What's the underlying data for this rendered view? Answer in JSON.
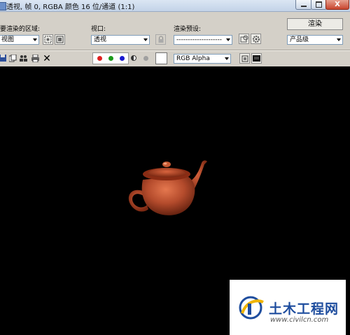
{
  "window": {
    "title": "透视, 帧 0, RGBA 颜色 16 位/通道 (1:1)",
    "close_label": "X"
  },
  "toolbar": {
    "area_label": "要渲染的区域:",
    "area_value": "视图",
    "viewport_label": "视口:",
    "viewport_value": "透视",
    "preset_label": "渲染预设:",
    "preset_value": "--------------------",
    "render_button": "渲染",
    "quality_value": "产品级"
  },
  "channels": {
    "display_value": "RGB Alpha",
    "colors": {
      "red": "#e02020",
      "green": "#1a9a1a",
      "blue": "#1a1ad0"
    }
  },
  "row2_icons": [
    "save-icon",
    "copy-icon",
    "clone-icon",
    "print-icon",
    "clear-icon"
  ],
  "watermark": {
    "title": "土木工程网",
    "url": "www.civilcn.com"
  }
}
